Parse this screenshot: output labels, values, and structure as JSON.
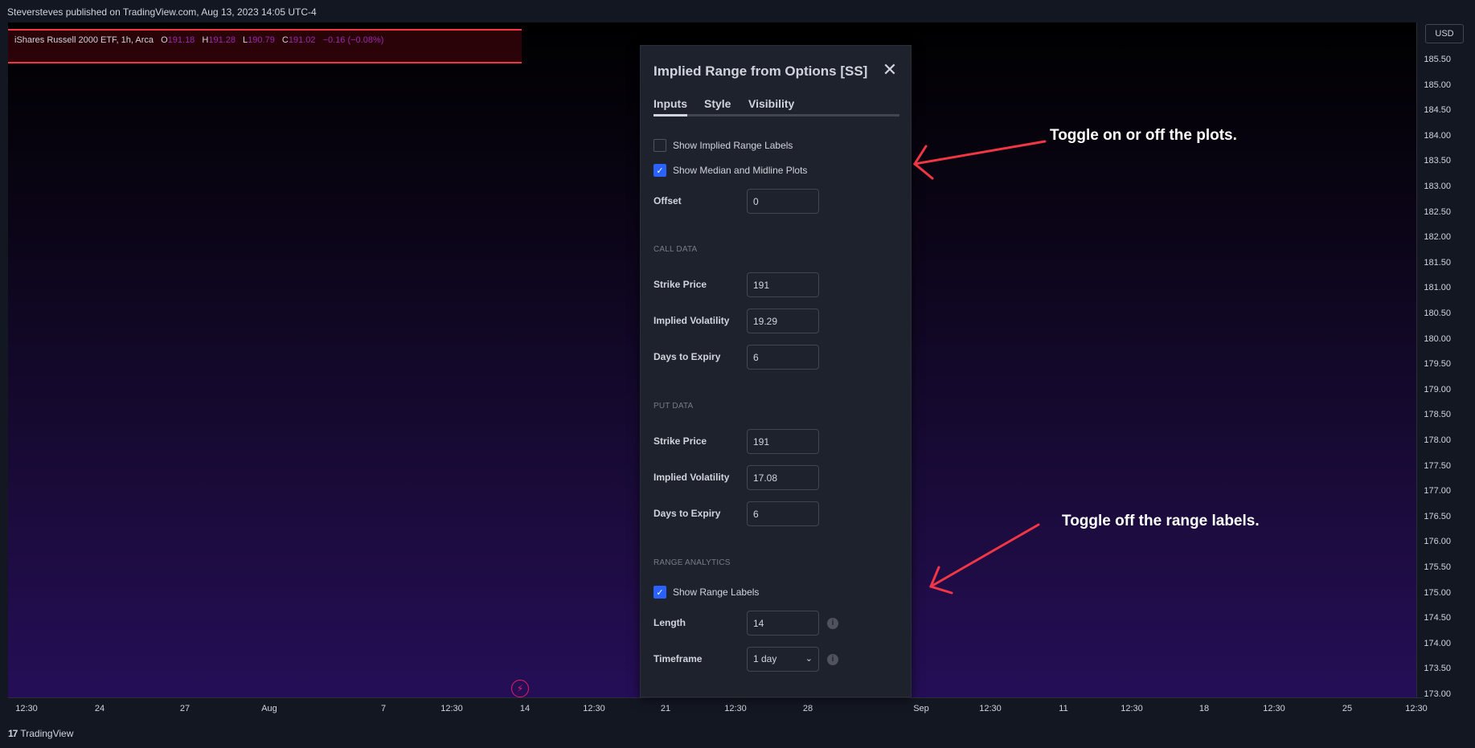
{
  "header": {
    "published": "Steversteves published on TradingView.com, Aug 13, 2023 14:05 UTC-4"
  },
  "legend": {
    "symbol": "iShares Russell 2000 ETF, 1h, Arca",
    "o_label": "O",
    "o_value": "191.18",
    "h_label": "H",
    "h_value": "191.28",
    "l_label": "L",
    "l_value": "190.79",
    "c_label": "C",
    "c_value": "191.02",
    "change": "−0.16 (−0.08%)",
    "value_color": "#9c27b0"
  },
  "price_axis": {
    "currency": "USD",
    "ticks": [
      "185.50",
      "185.00",
      "184.50",
      "184.00",
      "183.50",
      "183.00",
      "182.50",
      "182.00",
      "181.50",
      "181.00",
      "180.50",
      "180.00",
      "179.50",
      "179.00",
      "178.50",
      "178.00",
      "177.50",
      "177.00",
      "176.50",
      "176.00",
      "175.50",
      "175.00",
      "174.50",
      "174.00",
      "173.50",
      "173.00"
    ]
  },
  "time_axis": {
    "ticks": [
      "12:30",
      "24",
      "27",
      "Aug",
      "7",
      "12:30",
      "14",
      "12:30",
      "21",
      "12:30",
      "28",
      "Sep",
      "12:30",
      "11",
      "12:30",
      "18",
      "12:30",
      "25",
      "12:30"
    ]
  },
  "dialog": {
    "title": "Implied Range from Options [SS]",
    "close_icon": "close-icon",
    "tabs": [
      "Inputs",
      "Style",
      "Visibility"
    ],
    "active_tab": "Inputs",
    "show_implied_range_labels": {
      "label": "Show Implied Range Labels",
      "checked": false
    },
    "show_median_midline": {
      "label": "Show Median and Midline Plots",
      "checked": true
    },
    "offset": {
      "label": "Offset",
      "value": "0"
    },
    "call_section": "CALL DATA",
    "call_strike": {
      "label": "Strike Price",
      "value": "191"
    },
    "call_iv": {
      "label": "Implied Volatility",
      "value": "19.29"
    },
    "call_dte": {
      "label": "Days to Expiry",
      "value": "6"
    },
    "put_section": "PUT DATA",
    "put_strike": {
      "label": "Strike Price",
      "value": "191"
    },
    "put_iv": {
      "label": "Implied Volatility",
      "value": "17.08"
    },
    "put_dte": {
      "label": "Days to Expiry",
      "value": "6"
    },
    "range_section": "RANGE ANALYTICS",
    "show_range_labels": {
      "label": "Show Range Labels",
      "checked": true
    },
    "length": {
      "label": "Length",
      "value": "14"
    },
    "timeframe": {
      "label": "Timeframe",
      "value": "1 day"
    }
  },
  "annotations": {
    "plots": "Toggle on or off the plots.",
    "labels": "Toggle off the range labels.",
    "arrow_color": "#f23645"
  },
  "footer": {
    "brand": "TradingView",
    "logo_mark": "17"
  },
  "colors": {
    "accent": "#2962ff",
    "background": "#131722",
    "alert": "#e91e63"
  }
}
